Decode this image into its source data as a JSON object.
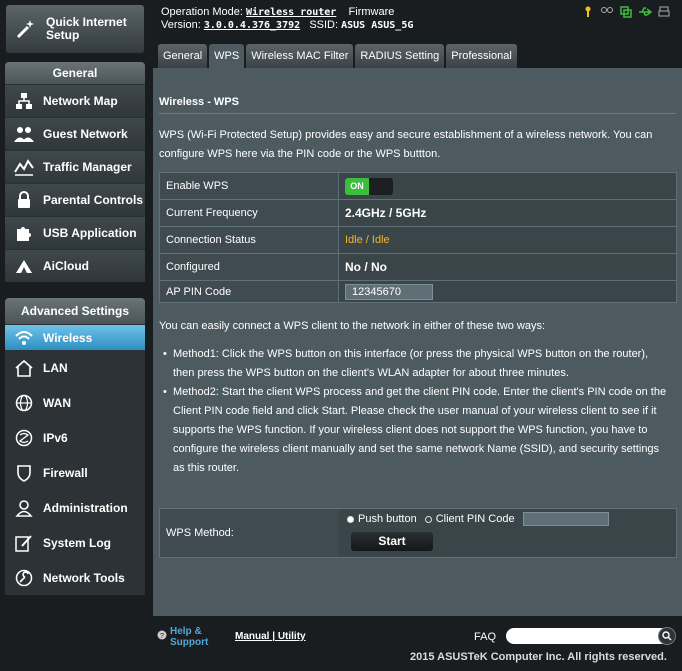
{
  "header": {
    "op_mode_label": "Operation Mode:",
    "op_mode_value": "Wireless router",
    "firmware_label": "Firmware",
    "version_label": "Version:",
    "version_value": "3.0.0.4.376_3792",
    "ssid_label": "SSID:",
    "ssid_value": "ASUS ASUS_5G"
  },
  "sidebar": {
    "quick_setup": "Quick Internet Setup",
    "general_title": "General",
    "general_items": [
      {
        "label": "Network Map"
      },
      {
        "label": "Guest Network"
      },
      {
        "label": "Traffic Manager"
      },
      {
        "label": "Parental Controls"
      },
      {
        "label": "USB Application"
      },
      {
        "label": "AiCloud"
      }
    ],
    "advanced_title": "Advanced Settings",
    "advanced_items": [
      {
        "label": "Wireless"
      },
      {
        "label": "LAN"
      },
      {
        "label": "WAN"
      },
      {
        "label": "IPv6"
      },
      {
        "label": "Firewall"
      },
      {
        "label": "Administration"
      },
      {
        "label": "System Log"
      },
      {
        "label": "Network Tools"
      }
    ]
  },
  "tabs": [
    "General",
    "WPS",
    "Wireless MAC Filter",
    "RADIUS Setting",
    "Professional"
  ],
  "main": {
    "title": "Wireless - WPS",
    "description": "WPS (Wi-Fi Protected Setup) provides easy and secure establishment of a wireless network. You can configure WPS here via the PIN code or the WPS buttton.",
    "rows": {
      "enable_wps_label": "Enable WPS",
      "enable_wps_state": "ON",
      "frequency_label": "Current Frequency",
      "frequency_value": "2.4GHz / 5GHz",
      "connection_label": "Connection Status",
      "connection_value": "Idle / Idle",
      "configured_label": "Configured",
      "configured_value": "No / No",
      "ap_pin_label": "AP PIN Code",
      "ap_pin_value": "12345670"
    },
    "ways_text": "You can easily connect a WPS client to the network in either of these two ways:",
    "method1": "Method1: Click the WPS button on this interface (or press the physical WPS button on the router), then press the WPS button on the client's WLAN adapter for about three minutes.",
    "method2": "Method2: Start the client WPS process and get the client PIN code. Enter the client's PIN code on the Client PIN code field and click Start. Please check the user manual of your wireless client to see if it supports the WPS function. If your wireless client does not support the WPS function, you have to configure the wireless client manually and set the same network Name (SSID), and security settings as this router.",
    "wps_method_label": "WPS Method:",
    "push_button_label": "Push button",
    "client_pin_label": "Client PIN Code",
    "start_label": "Start"
  },
  "footer": {
    "help_label": "Help & Support",
    "manual_label": "Manual",
    "separator": "|",
    "utility_label": "Utility",
    "faq_label": "FAQ",
    "copyright": "2015 ASUSTeK Computer Inc. All rights reserved."
  },
  "colors": {
    "accent": "#2d8fc0",
    "status_idle": "#f0b429",
    "toggle_on": "#3dbd3d"
  }
}
